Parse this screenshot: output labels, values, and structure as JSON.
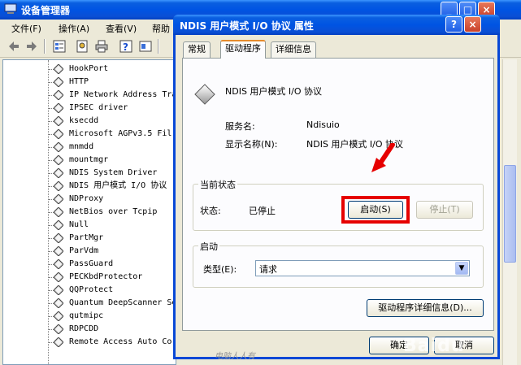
{
  "device_manager": {
    "title": "设备管理器",
    "menu": [
      "文件(F)",
      "操作(A)",
      "查看(V)",
      "帮助"
    ],
    "tree_items": [
      "HookPort",
      "HTTP",
      "IP Network Address Tra",
      "IPSEC driver",
      "ksecdd",
      "Microsoft AGPv3.5 Fil",
      "mnmdd",
      "mountmgr",
      "NDIS System Driver",
      "NDIS 用户模式 I/O 协议",
      "NDProxy",
      "NetBios over Tcpip",
      "Null",
      "PartMgr",
      "ParVdm",
      "PassGuard",
      "PECKbdProtector",
      "QQProtect",
      "Quantum DeepScanner Se",
      "qutmipc",
      "RDPCDD",
      "Remote Access Auto Co"
    ]
  },
  "dialog": {
    "title": "NDIS 用户模式 I/O 协议 属性",
    "help_btn": "?",
    "close_btn": "×",
    "tabs": [
      "常规",
      "驱动程序",
      "详细信息"
    ],
    "driver_name": "NDIS 用户模式 I/O 协议",
    "service_name_label": "服务名:",
    "service_name_value": "Ndisuio",
    "display_name_label": "显示名称(N):",
    "display_name_value": "NDIS 用户模式 I/O 协议",
    "current_status_group": "当前状态",
    "status_label": "状态:",
    "status_value": "已停止",
    "start_button": "启动(S)",
    "stop_button": "停止(T)",
    "startup_group": "启动",
    "type_label": "类型(E):",
    "type_value": "请求",
    "driver_details_button": "驱动程序详细信息(D)...",
    "ok_button": "确定",
    "cancel_button": "取消",
    "watermark": "电脑人人有",
    "baidu_logo": "Baidu"
  },
  "colors": {
    "titlebar": "#0054e3",
    "highlight": "#e60000",
    "window_bg": "#ece9d8"
  }
}
